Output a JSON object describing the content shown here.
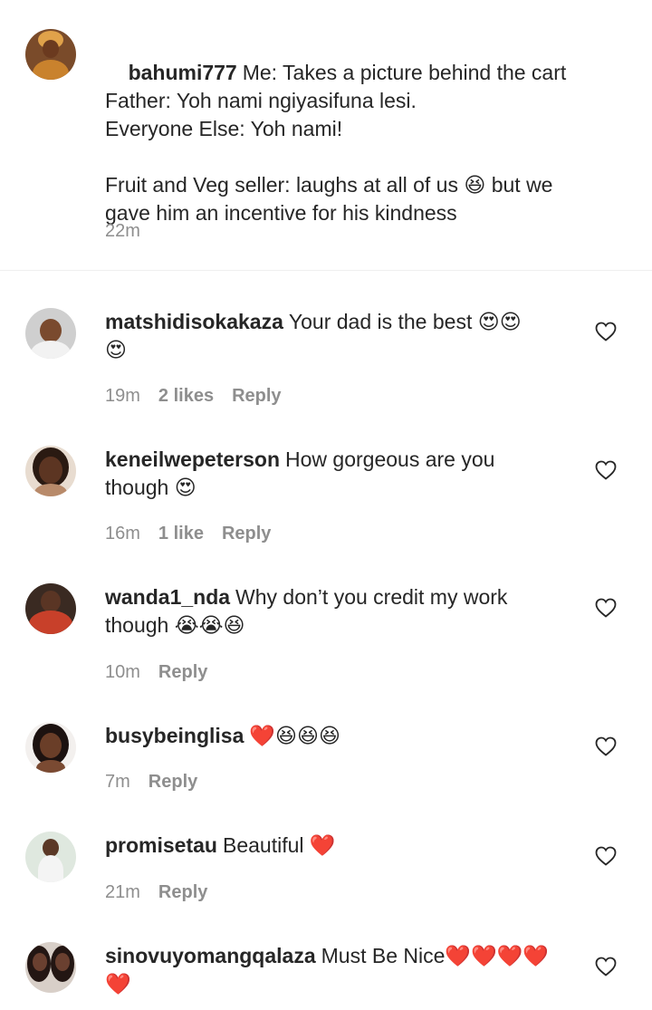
{
  "caption": {
    "username": "bahumi777",
    "lines": [
      "Me: Takes a picture behind the cart",
      "Father: Yoh nami ngiyasifuna lesi.",
      "Everyone Else: Yoh nami!",
      "",
      "Fruit and Veg seller: laughs at all of us 😆 but we",
      "gave him an incentive for his kindness"
    ],
    "time": "22m"
  },
  "comments": [
    {
      "username": "matshidisokakaza",
      "text": "Your dad is the best 😍😍\n😍",
      "time": "19m",
      "likes": "2 likes",
      "reply": "Reply"
    },
    {
      "username": "keneilwepeterson",
      "text": "How gorgeous are you\nthough 😍",
      "time": "16m",
      "likes": "1 like",
      "reply": "Reply"
    },
    {
      "username": "wanda1_nda",
      "text": "Why don’t you credit my work\nthough 😭😭😆",
      "time": "10m",
      "likes": "",
      "reply": "Reply"
    },
    {
      "username": "busybeinglisa",
      "text": "❤️😆😆😆",
      "time": "7m",
      "likes": "",
      "reply": "Reply"
    },
    {
      "username": "promisetau",
      "text": "Beautiful ❤️",
      "time": "21m",
      "likes": "",
      "reply": "Reply"
    },
    {
      "username": "sinovuyomangqalaza",
      "text": "Must Be Nice❤️❤️❤️❤️\n❤️",
      "time": "",
      "likes": "",
      "reply": ""
    }
  ],
  "icons": {
    "like": "heart-outline-icon"
  },
  "colors": {
    "text": "#262626",
    "meta": "#8e8e8e",
    "divider": "#efefef"
  }
}
